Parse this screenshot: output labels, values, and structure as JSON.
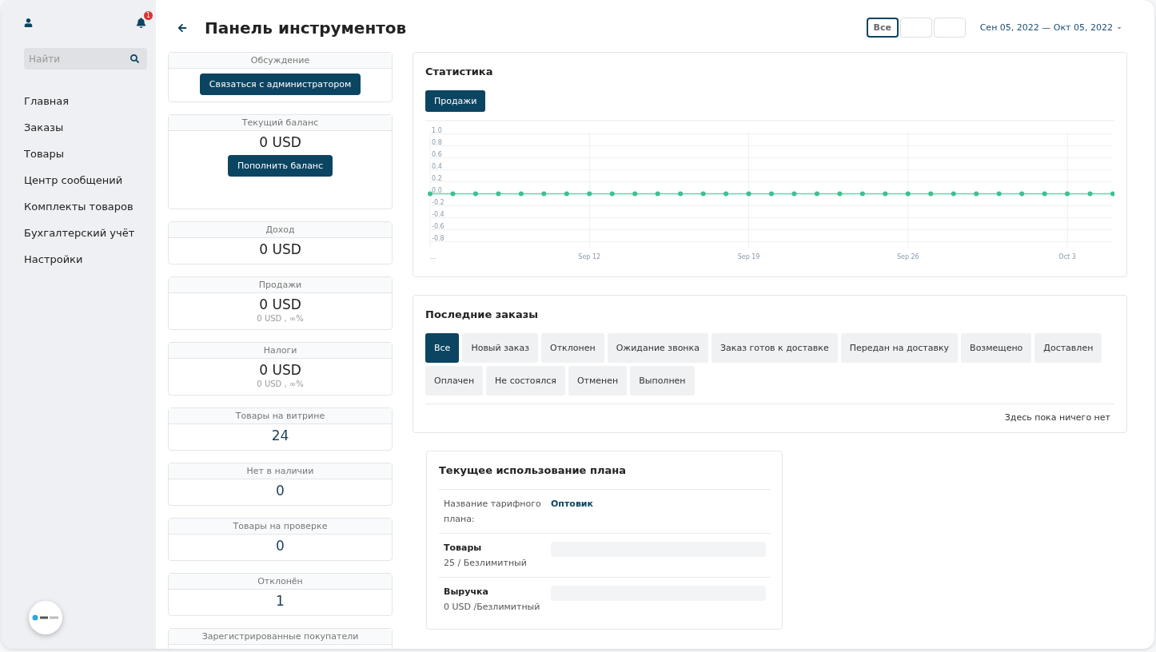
{
  "sidebar": {
    "notifications_badge": "1",
    "search": {
      "placeholder": "Найти"
    },
    "items": [
      {
        "label": "Главная"
      },
      {
        "label": "Заказы"
      },
      {
        "label": "Товары"
      },
      {
        "label": "Центр сообщений"
      },
      {
        "label": "Комплекты товаров"
      },
      {
        "label": "Бухгалтерский учёт"
      },
      {
        "label": "Настройки"
      }
    ]
  },
  "header": {
    "title": "Панель инструментов",
    "period_buttons": [
      {
        "label": "Все",
        "selected": true
      },
      {
        "selected": false
      },
      {
        "selected": false
      }
    ],
    "date_range": "Сен 05, 2022 — Окт 05, 2022"
  },
  "stat_cards": [
    {
      "kind": "button",
      "title": "Обсуждение",
      "button": "Связаться с администратором"
    },
    {
      "kind": "balance",
      "title": "Текущий баланс",
      "value": "0 USD",
      "button": "Пополнить баланс"
    },
    {
      "kind": "value",
      "title": "Доход",
      "value": "0 USD"
    },
    {
      "kind": "value",
      "title": "Продажи",
      "value": "0 USD",
      "sub": "0 USD , ∞%"
    },
    {
      "kind": "value",
      "title": "Налоги",
      "value": "0 USD",
      "sub": "0 USD , ∞%"
    },
    {
      "kind": "count",
      "title": "Товары на витрине",
      "value": "24"
    },
    {
      "kind": "count",
      "title": "Нет в наличии",
      "value": "0"
    },
    {
      "kind": "count",
      "title": "Товары на проверке",
      "value": "0"
    },
    {
      "kind": "count",
      "title": "Отклонён",
      "value": "1"
    },
    {
      "kind": "count",
      "title": "Зарегистрированные покупатели"
    }
  ],
  "statistics": {
    "title": "Статистика",
    "tabs": [
      {
        "label": "Продажи",
        "selected": true
      }
    ],
    "chart_data": {
      "type": "line",
      "categories": [
        "...",
        null,
        null,
        null,
        null,
        null,
        null,
        "Sep 12",
        null,
        null,
        null,
        null,
        null,
        null,
        "Sep 19",
        null,
        null,
        null,
        null,
        null,
        null,
        "Sep 26",
        null,
        null,
        null,
        null,
        null,
        null,
        "Oct 3",
        null,
        null
      ],
      "grid": true,
      "series": [
        {
          "color": "#3cc18f",
          "marker": true,
          "values": [
            0,
            0,
            0,
            0,
            0,
            0,
            0,
            0,
            0,
            0,
            0,
            0,
            0,
            0,
            0,
            0,
            0,
            0,
            0,
            0,
            0,
            0,
            0,
            0,
            0,
            0,
            0,
            0,
            0,
            0,
            0
          ]
        }
      ],
      "ylim": [
        -0.9,
        1.05
      ],
      "yticks": [
        -0.8,
        -0.6,
        -0.4,
        -0.2,
        {
          "value": 0,
          "label": "0.0"
        },
        0.2,
        0.4,
        0.6,
        0.8,
        {
          "value": 1,
          "label": "1.0"
        }
      ]
    }
  },
  "recent_orders": {
    "title": "Последние заказы",
    "filters": [
      {
        "label": "Все",
        "selected": true
      },
      {
        "label": "Новый заказ",
        "selected": false
      },
      {
        "label": "Отклонен",
        "selected": false
      },
      {
        "label": "Ожидание звонка",
        "selected": false
      },
      {
        "label": "Заказ готов к доставке",
        "selected": false
      },
      {
        "label": "Передан на доставку",
        "selected": false
      },
      {
        "label": "Возмещено",
        "selected": false
      },
      {
        "label": "Доставлен",
        "selected": false
      },
      {
        "label": "Оплачен",
        "selected": false
      },
      {
        "label": "Не состоялся",
        "selected": false
      },
      {
        "label": "Отменен",
        "selected": false
      },
      {
        "label": "Выполнен",
        "selected": false
      }
    ],
    "empty_text": "Здесь пока ничего нет"
  },
  "plan_usage": {
    "title": "Текущее использование плана",
    "plan_label": "Название тарифного плана:",
    "plan_name": "Оптовик",
    "limits": [
      {
        "label": "Товары",
        "usage": "25 / Безлимитный"
      },
      {
        "label": "Выручка",
        "usage": "0 USD /Безлимитный"
      }
    ]
  }
}
